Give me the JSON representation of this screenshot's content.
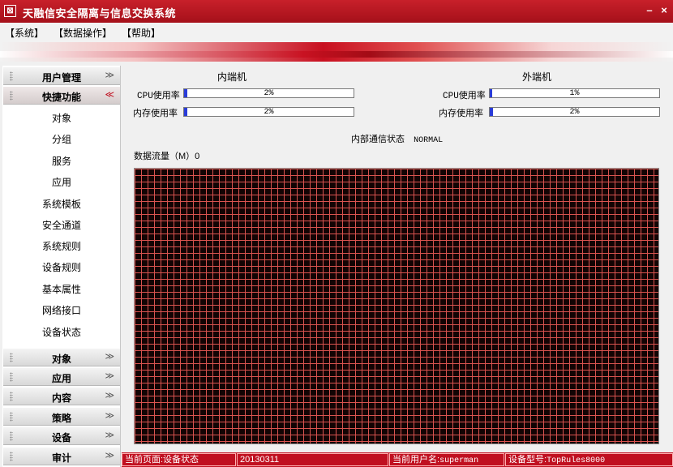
{
  "window": {
    "title": "天融信安全隔离与信息交换系统",
    "minimize": "–",
    "close": "×"
  },
  "menu": [
    "【系统】",
    "【数据操作】",
    "【帮助】"
  ],
  "sidebar": {
    "sections": [
      {
        "label": "用户管理",
        "chevron": "≫"
      },
      {
        "label": "快捷功能",
        "chevron": "≪"
      },
      {
        "label": "对象",
        "chevron": "≫"
      },
      {
        "label": "应用",
        "chevron": "≫"
      },
      {
        "label": "内容",
        "chevron": "≫"
      },
      {
        "label": "策略",
        "chevron": "≫"
      },
      {
        "label": "设备",
        "chevron": "≫"
      },
      {
        "label": "审计",
        "chevron": "≫"
      }
    ],
    "items": [
      "对象",
      "分组",
      "服务",
      "应用",
      "系统模板",
      "安全通道",
      "系统规则",
      "设备规则",
      "基本属性",
      "网络接口",
      "设备状态"
    ]
  },
  "main": {
    "inner": {
      "title": "内端机",
      "cpu_label": "CPU使用率",
      "cpu_value": "2%",
      "cpu_fraction": 0.02,
      "mem_label": "内存使用率",
      "mem_value": "2%",
      "mem_fraction": 0.02
    },
    "outer": {
      "title": "外端机",
      "cpu_label": "CPU使用率",
      "cpu_value": "1%",
      "cpu_fraction": 0.01,
      "mem_label": "内存使用率",
      "mem_value": "2%",
      "mem_fraction": 0.02
    },
    "comm_status_label": "内部通信状态",
    "comm_status_value": "NORMAL",
    "traffic_label": "数据流量（M）0"
  },
  "statusbar": {
    "current_page": "当前页面:设备状态",
    "date": "20130311",
    "current_user_label": "当前用户名:",
    "current_user": "superman",
    "device_model_label": "设备型号:",
    "device_model": "TopRules8000"
  },
  "colors": {
    "accent": "#c01020",
    "progress_fill": "#2a3cd8",
    "chart_bg": "#120404",
    "chart_grid": "#d9534f"
  }
}
